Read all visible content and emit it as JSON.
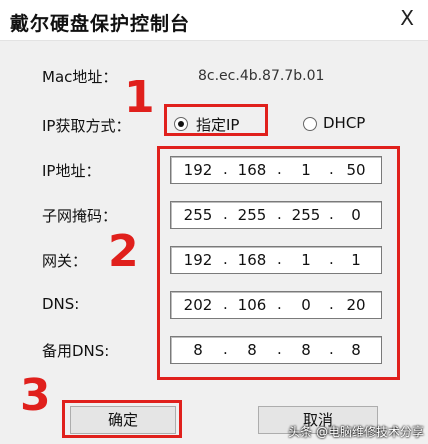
{
  "window": {
    "title": "戴尔硬盘保护控制台",
    "close_glyph": "X"
  },
  "mac": {
    "label": "Mac地址：",
    "value": "8c.ec.4b.87.7b.01"
  },
  "ip_mode": {
    "label": "IP获取方式：",
    "option_static": "指定IP",
    "option_dhcp": "DHCP",
    "selected": "指定IP"
  },
  "fields": [
    {
      "label": "IP地址：",
      "octets": [
        "192",
        "168",
        "1",
        "50"
      ]
    },
    {
      "label": "子网掩码：",
      "octets": [
        "255",
        "255",
        "255",
        "0"
      ]
    },
    {
      "label": "网关：",
      "octets": [
        "192",
        "168",
        "1",
        "1"
      ]
    },
    {
      "label": "DNS:",
      "octets": [
        "202",
        "106",
        "0",
        "20"
      ]
    },
    {
      "label": "备用DNS:",
      "octets": [
        "8",
        "8",
        "8",
        "8"
      ]
    }
  ],
  "buttons": {
    "ok": "确定",
    "cancel": "取消"
  },
  "annotations": {
    "step1": "1",
    "step2": "2",
    "step3": "3",
    "color": "#e0201c"
  },
  "watermark": "头条 @电脑维修技术分享"
}
